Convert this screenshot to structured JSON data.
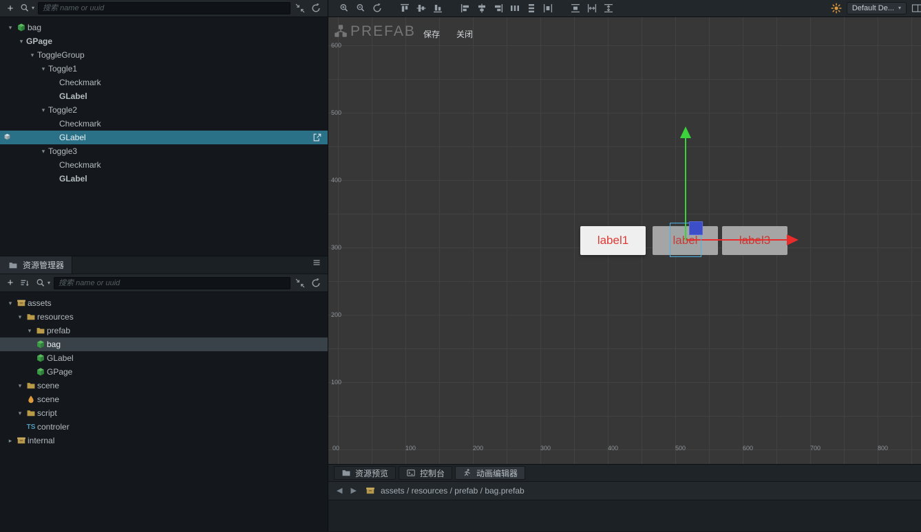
{
  "colors": {
    "selection_teal": "#2a7086",
    "tree_green": "#73bd74",
    "label_red": "#dd3a36",
    "gizmo_green": "#3bd23b",
    "gizmo_red": "#e82c2c",
    "gizmo_blue": "#3d4ec9",
    "accent_orange": "#dd983e"
  },
  "top_toolbar": {
    "search_placeholder": "搜索 name or uuid",
    "scene_tools": [
      "zoom-in",
      "zoom-out",
      "refresh-view",
      "align-top",
      "align-middle",
      "align-bottom",
      "align-left",
      "align-center",
      "align-right",
      "distribute-horizontal",
      "distribute-vertical",
      "space-horizontal",
      "space-vertical",
      "stretch-horizontal",
      "stretch-vertical"
    ],
    "device_dropdown": "Default De..."
  },
  "hierarchy_panel": {
    "nodes": [
      {
        "label": "bag",
        "depth": 0,
        "arrow": "open",
        "icon": "prefab",
        "tone": "white"
      },
      {
        "label": "GPage",
        "depth": 1,
        "arrow": "open",
        "tone": "bright"
      },
      {
        "label": "ToggleGroup",
        "depth": 2,
        "arrow": "open",
        "tone": "green"
      },
      {
        "label": "Toggle1",
        "depth": 3,
        "arrow": "open",
        "tone": "green"
      },
      {
        "label": "Checkmark",
        "depth": 4,
        "tone": "green"
      },
      {
        "label": "GLabel",
        "depth": 4,
        "tone": "green-bold"
      },
      {
        "label": "Toggle2",
        "depth": 3,
        "arrow": "open",
        "tone": "green"
      },
      {
        "label": "Checkmark",
        "depth": 4,
        "tone": "gray"
      },
      {
        "label": "GLabel",
        "depth": 4,
        "tone": "white",
        "selected": true
      },
      {
        "label": "Toggle3",
        "depth": 3,
        "arrow": "open",
        "tone": "green"
      },
      {
        "label": "Checkmark",
        "depth": 4,
        "tone": "gray"
      },
      {
        "label": "GLabel",
        "depth": 4,
        "tone": "green-bold"
      }
    ]
  },
  "assets_panel": {
    "title": "资源管理器",
    "search_placeholder": "搜索 name or uuid",
    "nodes": [
      {
        "label": "assets",
        "depth": 0,
        "arrow": "open",
        "icon": "db"
      },
      {
        "label": "resources",
        "depth": 1,
        "arrow": "open",
        "icon": "folder"
      },
      {
        "label": "prefab",
        "depth": 2,
        "arrow": "open",
        "icon": "folder"
      },
      {
        "label": "bag",
        "depth": 3,
        "icon": "prefab",
        "selected": true
      },
      {
        "label": "GLabel",
        "depth": 3,
        "icon": "prefab"
      },
      {
        "label": "GPage",
        "depth": 3,
        "icon": "prefab"
      },
      {
        "label": "scene",
        "depth": 1,
        "arrow": "open",
        "icon": "folder"
      },
      {
        "label": "scene",
        "depth": 2,
        "icon": "scene"
      },
      {
        "label": "script",
        "depth": 1,
        "arrow": "open",
        "icon": "folder"
      },
      {
        "label": "controler",
        "depth": 2,
        "icon": "ts"
      },
      {
        "label": "internal",
        "depth": 0,
        "arrow": "closed",
        "icon": "db"
      }
    ]
  },
  "scene_view": {
    "mode_title": "PREFAB",
    "save_label": "保存",
    "close_label": "关闭",
    "ruler_y": [
      "600",
      "500",
      "400",
      "300",
      "200",
      "100"
    ],
    "ruler_x": [
      "00",
      "100",
      "200",
      "300",
      "400",
      "500",
      "600",
      "700",
      "800"
    ],
    "labels": [
      {
        "text": "label1",
        "style": "light"
      },
      {
        "text": "label",
        "style": "gray"
      },
      {
        "text": "label3",
        "style": "gray"
      }
    ]
  },
  "bottom_panel": {
    "tabs": [
      {
        "label": "资源预览",
        "icon": "folder"
      },
      {
        "label": "控制台",
        "icon": "console"
      },
      {
        "label": "动画编辑器",
        "icon": "animation"
      }
    ],
    "breadcrumb": "assets / resources / prefab / bag.prefab"
  }
}
